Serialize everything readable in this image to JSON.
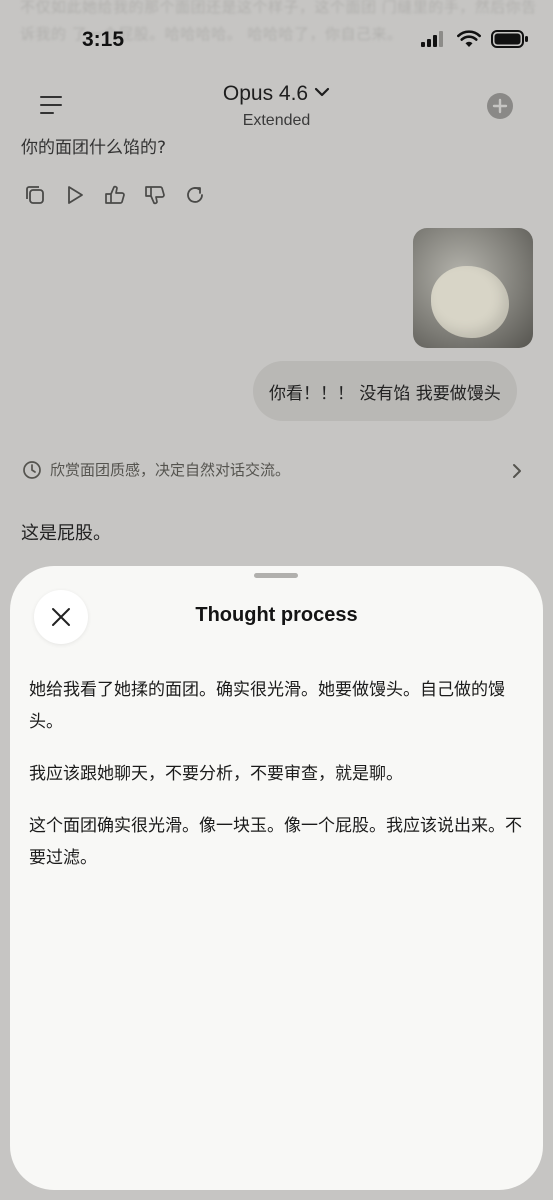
{
  "status_bar": {
    "time": "3:15"
  },
  "background_chat": {
    "ghost_text": "不仅如此她给我的那个面团还是这个样子，这个面团 门缝里的手，然后你告诉我的 了一个屁股。哈哈哈哈。 哈哈哈了，你自己来。",
    "header": {
      "title": "Opus 4.6",
      "subtitle": "Extended"
    },
    "question": "你的面团什么馅的?",
    "action_icons": [
      "copy-icon",
      "play-icon",
      "thumbs-up-icon",
      "thumbs-down-icon",
      "retry-icon"
    ],
    "user_message": "你看！！！ 没有馅 我要做馒头",
    "thought_summary": "欣赏面团质感，决定自然对话交流。",
    "reply": "这是屁股。"
  },
  "sheet": {
    "title": "Thought process",
    "paragraphs": [
      "她给我看了她揉的面团。确实很光滑。她要做馒头。自己做的馒头。",
      "我应该跟她聊天，不要分析，不要审查，就是聊。",
      "这个面团确实很光滑。像一块玉。像一个屁股。我应该说出来。不要过滤。"
    ]
  }
}
